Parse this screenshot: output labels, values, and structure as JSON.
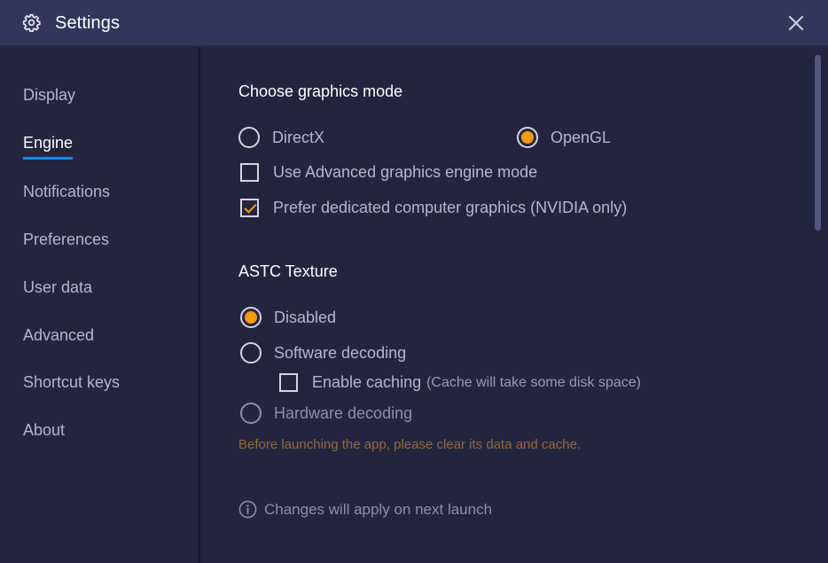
{
  "window": {
    "title": "Settings",
    "icon": "gear-icon",
    "close_icon": "close-icon"
  },
  "sidebar": {
    "items": [
      {
        "label": "Display",
        "active": false
      },
      {
        "label": "Engine",
        "active": true
      },
      {
        "label": "Notifications",
        "active": false
      },
      {
        "label": "Preferences",
        "active": false
      },
      {
        "label": "User data",
        "active": false
      },
      {
        "label": "Advanced",
        "active": false
      },
      {
        "label": "Shortcut keys",
        "active": false
      },
      {
        "label": "About",
        "active": false
      }
    ]
  },
  "graphics": {
    "title": "Choose graphics mode",
    "modes": [
      {
        "label": "DirectX",
        "selected": false
      },
      {
        "label": "OpenGL",
        "selected": true
      }
    ],
    "advanced_engine": {
      "label": "Use Advanced graphics engine mode",
      "checked": false
    },
    "dedicated_gpu": {
      "label": "Prefer dedicated computer graphics (NVIDIA only)",
      "checked": true
    }
  },
  "astc": {
    "title": "ASTC Texture",
    "options": [
      {
        "label": "Disabled",
        "selected": true
      },
      {
        "label": "Software decoding",
        "selected": false
      },
      {
        "label": "Hardware decoding",
        "selected": false
      }
    ],
    "caching": {
      "label": "Enable caching",
      "note": "(Cache will take some disk space)",
      "checked": false
    },
    "warning": "Before launching the app, please clear its data and cache."
  },
  "footer": {
    "info_icon": "info-icon",
    "note": "Changes will apply on next launch"
  },
  "colors": {
    "accent": "#f49a0e",
    "active_underline": "#1a8ae8",
    "warning_text": "#946838",
    "titlebar_bg": "#33365b",
    "body_bg": "#23253f"
  }
}
